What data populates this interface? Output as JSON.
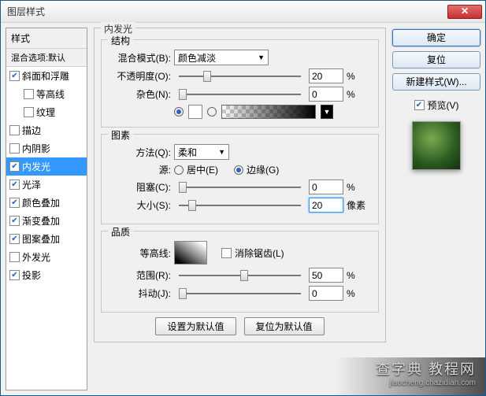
{
  "window": {
    "title": "图层样式"
  },
  "sidebar": {
    "header": "样式",
    "subheader": "混合选项:默认",
    "items": [
      {
        "label": "斜面和浮雕",
        "checked": true,
        "indent": false
      },
      {
        "label": "等高线",
        "checked": false,
        "indent": true
      },
      {
        "label": "纹理",
        "checked": false,
        "indent": true
      },
      {
        "label": "描边",
        "checked": false,
        "indent": false
      },
      {
        "label": "内阴影",
        "checked": false,
        "indent": false
      },
      {
        "label": "内发光",
        "checked": true,
        "indent": false,
        "selected": true
      },
      {
        "label": "光泽",
        "checked": true,
        "indent": false
      },
      {
        "label": "颜色叠加",
        "checked": true,
        "indent": false
      },
      {
        "label": "渐变叠加",
        "checked": true,
        "indent": false
      },
      {
        "label": "图案叠加",
        "checked": true,
        "indent": false
      },
      {
        "label": "外发光",
        "checked": false,
        "indent": false
      },
      {
        "label": "投影",
        "checked": true,
        "indent": false
      }
    ]
  },
  "panel": {
    "title": "内发光",
    "structure": {
      "legend": "结构",
      "blend_label": "混合模式(B):",
      "blend_value": "颜色减淡",
      "opacity_label": "不透明度(O):",
      "opacity_value": "20",
      "opacity_unit": "%",
      "noise_label": "杂色(N):",
      "noise_value": "0",
      "noise_unit": "%"
    },
    "elements": {
      "legend": "图素",
      "method_label": "方法(Q):",
      "method_value": "柔和",
      "source_label": "源:",
      "source_center": "居中(E)",
      "source_edge": "边缘(G)",
      "choke_label": "阻塞(C):",
      "choke_value": "0",
      "choke_unit": "%",
      "size_label": "大小(S):",
      "size_value": "20",
      "size_unit": "像素"
    },
    "quality": {
      "legend": "品质",
      "contour_label": "等高线:",
      "antialias_label": "消除锯齿(L)",
      "range_label": "范围(R):",
      "range_value": "50",
      "range_unit": "%",
      "jitter_label": "抖动(J):",
      "jitter_value": "0",
      "jitter_unit": "%"
    },
    "buttons": {
      "make_default": "设置为默认值",
      "reset_default": "复位为默认值"
    }
  },
  "right": {
    "ok": "确定",
    "cancel": "复位",
    "new_style": "新建样式(W)...",
    "preview": "预览(V)"
  },
  "watermark": {
    "big": "查字典 教程网",
    "small": "jiaocheng.chazidian.com"
  }
}
